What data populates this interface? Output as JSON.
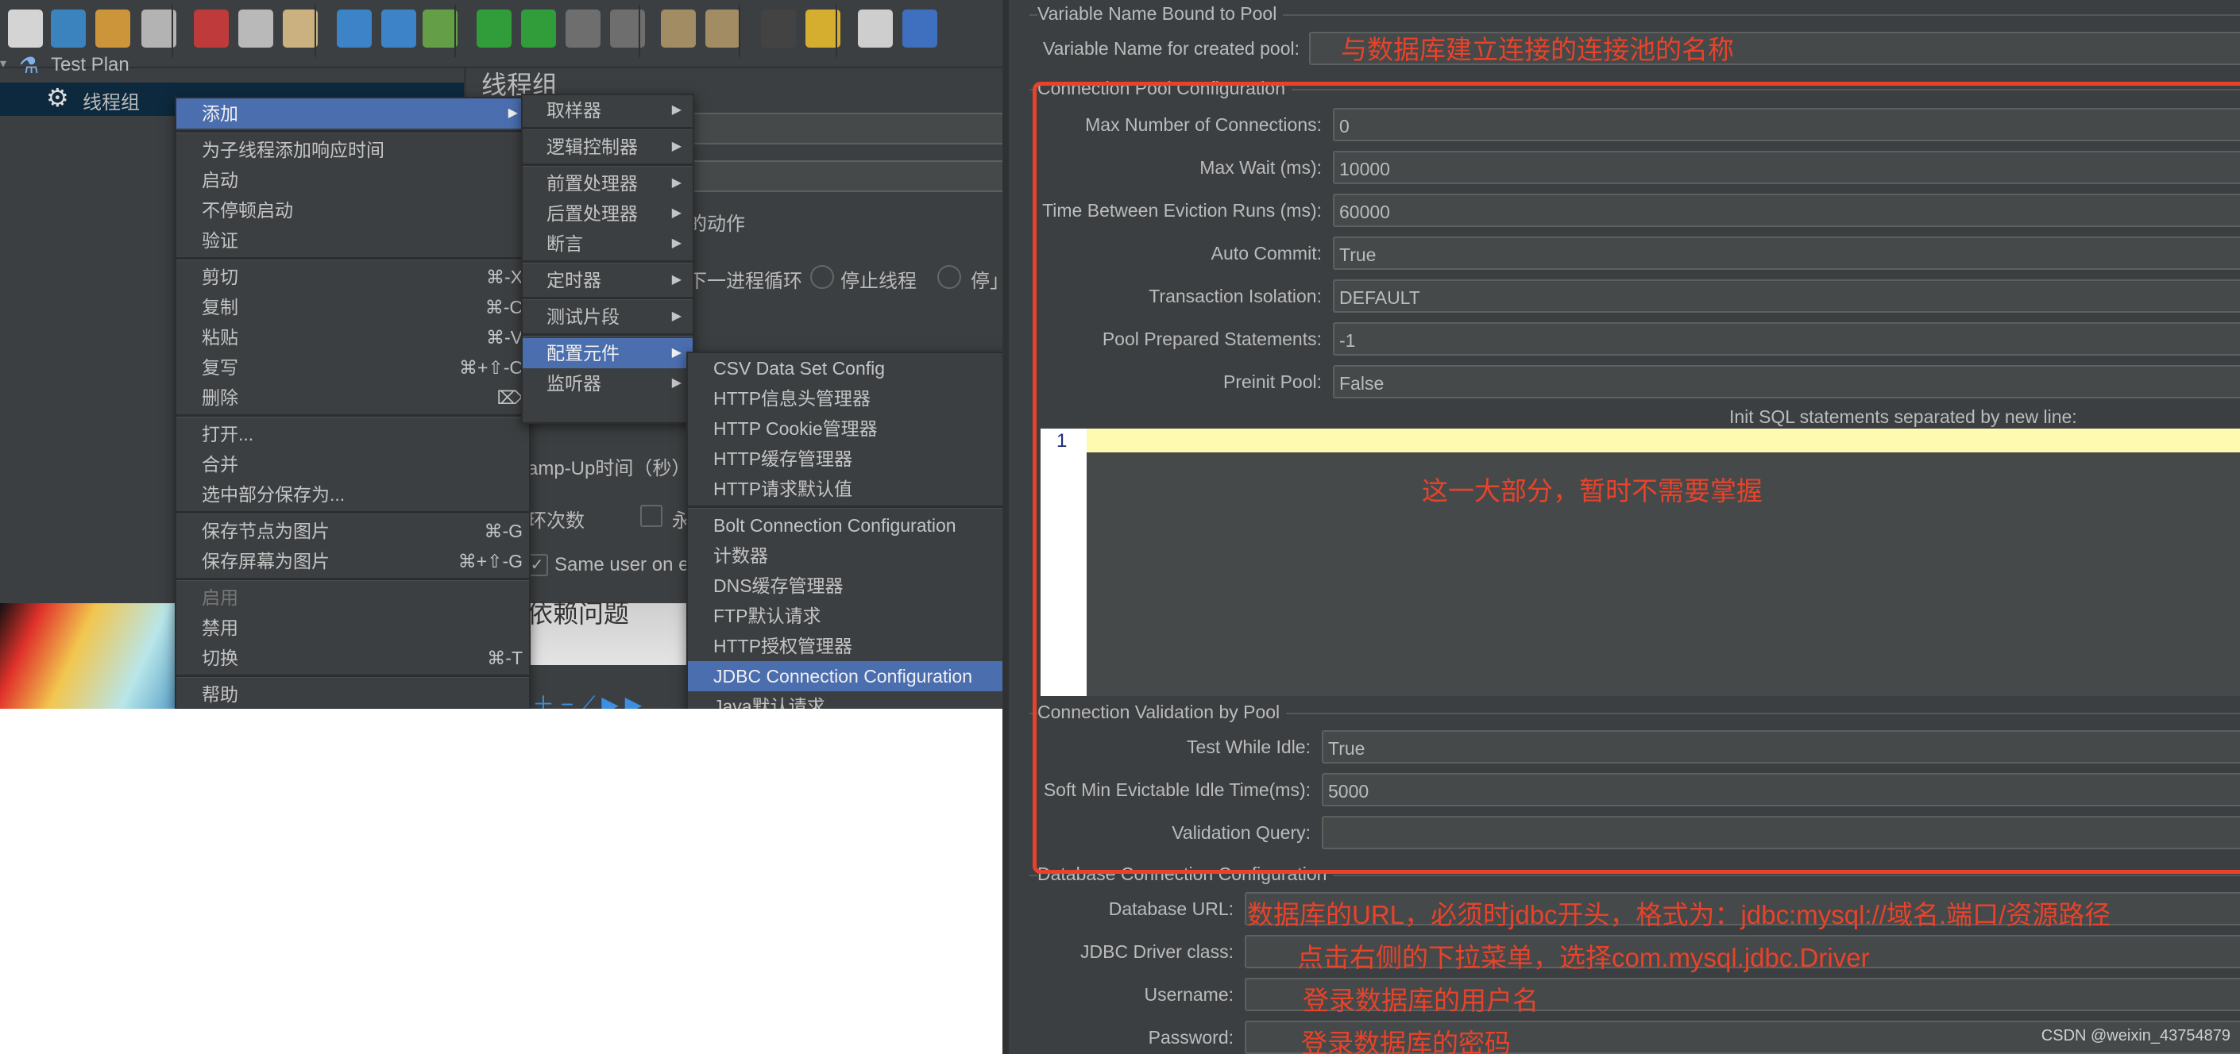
{
  "toolbar": {
    "icons": [
      "new-template-icon",
      "open-templates-icon",
      "open-icon",
      "save-icon",
      "cut-icon",
      "copy-icon",
      "paste-icon",
      "expand-icon",
      "collapse-icon",
      "toggle-icon",
      "start-icon",
      "start-no-pause-icon",
      "stop-icon",
      "shutdown-icon",
      "clear-icon",
      "clear-all-icon",
      "search-icon",
      "reset-search-icon",
      "function-helper-icon",
      "help-icon"
    ],
    "colors": [
      "#eeeeee",
      "#3a8fd6",
      "#e6a53a",
      "#c8c8c8",
      "#d63a3a",
      "#cfcfcf",
      "#e3c58b",
      "#3d8fe0",
      "#3d8fe0",
      "#6bb04a",
      "#2fae3a",
      "#2fae3a",
      "#777777",
      "#777777",
      "#b49a6a",
      "#b49a6a",
      "#444444",
      "#f0c22e",
      "#e8e8e8",
      "#3f78d6"
    ]
  },
  "tree": {
    "test_plan": "Test Plan",
    "thread_group": "线程组"
  },
  "background_panel": {
    "title": "线程组",
    "action_suffix": "的动作",
    "next_loop": "下一进程循环",
    "stop_thread": "停止线程",
    "stop_test": "停」",
    "ramp_up": "amp-Up时间（秒）",
    "loop_count": "环次数",
    "forever": "永",
    "same_user": "Same user on e",
    "dependency": "包的依赖问题",
    "warning": "warning"
  },
  "context_menu": {
    "groups": [
      [
        {
          "label": "添加",
          "arrow": true,
          "highlight": true
        }
      ],
      [
        {
          "label": "为子线程添加响应时间"
        },
        {
          "label": "启动"
        },
        {
          "label": "不停顿启动"
        },
        {
          "label": "验证"
        }
      ],
      [
        {
          "label": "剪切",
          "shortcut": "⌘-X"
        },
        {
          "label": "复制",
          "shortcut": "⌘-C"
        },
        {
          "label": "粘贴",
          "shortcut": "⌘-V"
        },
        {
          "label": "复写",
          "shortcut": "⌘+⇧-C"
        },
        {
          "label": "删除",
          "shortcut": "⌦"
        }
      ],
      [
        {
          "label": "打开..."
        },
        {
          "label": "合并"
        },
        {
          "label": "选中部分保存为..."
        }
      ],
      [
        {
          "label": "保存节点为图片",
          "shortcut": "⌘-G"
        },
        {
          "label": "保存屏幕为图片",
          "shortcut": "⌘+⇧-G"
        }
      ],
      [
        {
          "label": "启用",
          "disabled": true
        },
        {
          "label": "禁用"
        },
        {
          "label": "切换",
          "shortcut": "⌘-T"
        }
      ],
      [
        {
          "label": "帮助"
        }
      ]
    ]
  },
  "add_submenu": {
    "groups": [
      [
        {
          "label": "取样器",
          "arrow": true
        }
      ],
      [
        {
          "label": "逻辑控制器",
          "arrow": true
        }
      ],
      [
        {
          "label": "前置处理器",
          "arrow": true
        },
        {
          "label": "后置处理器",
          "arrow": true
        },
        {
          "label": "断言",
          "arrow": true
        }
      ],
      [
        {
          "label": "定时器",
          "arrow": true
        }
      ],
      [
        {
          "label": "测试片段",
          "arrow": true
        }
      ],
      [
        {
          "label": "配置元件",
          "arrow": true,
          "highlight": true
        },
        {
          "label": "监听器",
          "arrow": true
        }
      ]
    ]
  },
  "config_submenu": {
    "groups": [
      [
        {
          "label": "CSV Data Set Config"
        },
        {
          "label": "HTTP信息头管理器"
        },
        {
          "label": "HTTP Cookie管理器"
        },
        {
          "label": "HTTP缓存管理器"
        },
        {
          "label": "HTTP请求默认值"
        }
      ],
      [
        {
          "label": "Bolt Connection Configuration"
        },
        {
          "label": "计数器"
        },
        {
          "label": "DNS缓存管理器"
        },
        {
          "label": "FTP默认请求"
        },
        {
          "label": "HTTP授权管理器"
        },
        {
          "label": "JDBC Connection Configuration",
          "highlight": true
        },
        {
          "label": "Java默认请求"
        }
      ]
    ]
  },
  "jdbc_form": {
    "variable_section": "Variable Name Bound to Pool",
    "variable_label": "Variable Name for created pool:",
    "variable_value": "",
    "pool_section": "Connection Pool Configuration",
    "pool_fields": [
      {
        "label": "Max Number of Connections:",
        "value": "0"
      },
      {
        "label": "Max Wait (ms):",
        "value": "10000"
      },
      {
        "label": "Time Between Eviction Runs (ms):",
        "value": "60000"
      },
      {
        "label": "Auto Commit:",
        "value": "True"
      },
      {
        "label": "Transaction Isolation:",
        "value": "DEFAULT"
      },
      {
        "label": "Pool Prepared Statements:",
        "value": "-1"
      },
      {
        "label": "Preinit Pool:",
        "value": "False"
      }
    ],
    "init_sql_label": "Init SQL statements separated by new line:",
    "init_sql_line_number": "1",
    "validation_section": "Connection Validation by Pool",
    "validation_fields": [
      {
        "label": "Test While Idle:",
        "value": "True"
      },
      {
        "label": "Soft Min Evictable Idle Time(ms):",
        "value": "5000"
      },
      {
        "label": "Validation Query:",
        "value": ""
      }
    ],
    "db_section": "Database Connection Configuration",
    "db_fields": [
      {
        "label": "Database URL:",
        "value": ""
      },
      {
        "label": "JDBC Driver class:",
        "value": ""
      },
      {
        "label": "Username:",
        "value": ""
      },
      {
        "label": "Password:",
        "value": ""
      }
    ]
  },
  "annotations": {
    "variable": "与数据库建立连接的连接池的名称",
    "pool": "这一大部分，暂时不需要掌握",
    "db_url": "数据库的URL，必须时jdbc开头，格式为：jdbc:mysql://域名.端口/资源路径",
    "driver": "点击右侧的下拉菜单，选择com.mysql.jdbc.Driver",
    "username": "登录数据库的用户名",
    "password": "登录数据库的密码",
    "color": "#e8432a"
  },
  "watermark": "CSDN @weixin_43754879"
}
